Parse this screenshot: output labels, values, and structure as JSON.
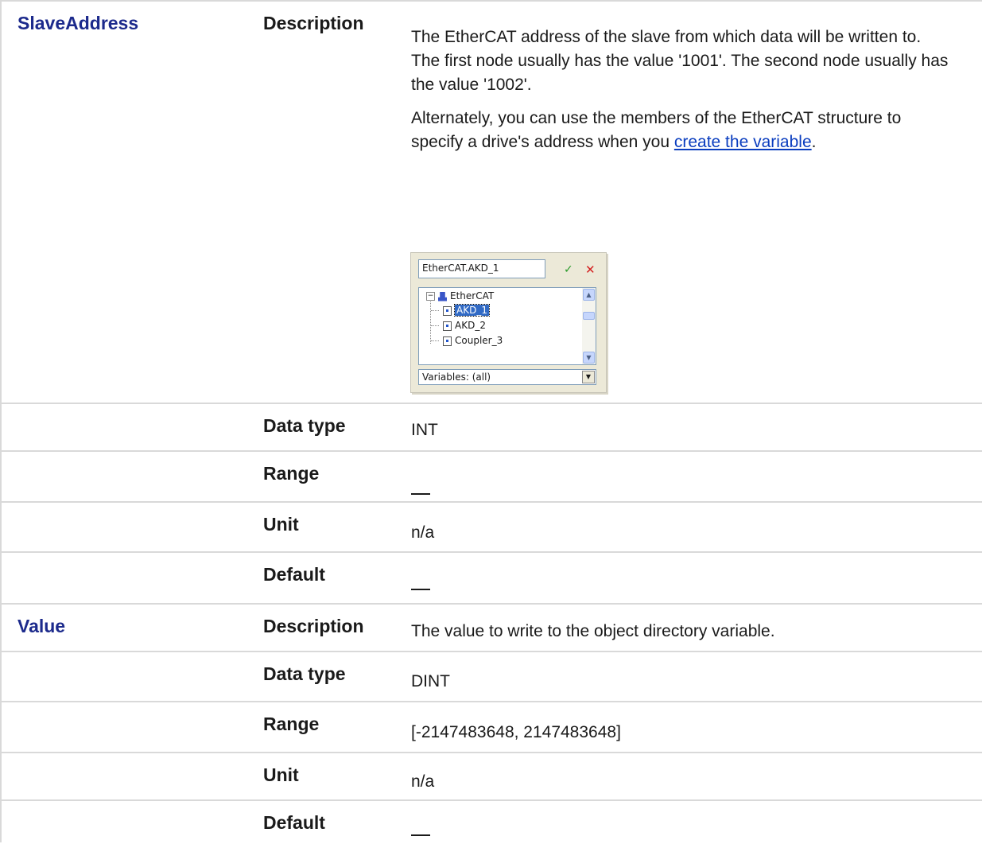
{
  "slave": {
    "name": "SlaveAddress",
    "description_label": "Description",
    "description_p1": "The EtherCAT address of the slave from which data will be written to.",
    "description_p2": "The first node usually has the value '1001'. The second node usually has the value '1002'.",
    "description_p3_pre": "Alternately, you can use the members of the EtherCAT structure to specify a drive's address when you",
    "description_link": "create the variable",
    "description_p3_post": ".",
    "datatype_label": "Data type",
    "datatype": "INT",
    "range_label": "Range",
    "unit_label": "Unit",
    "unit": "n/a",
    "default_label": "Default"
  },
  "dialog": {
    "input_value": "EtherCAT.AKD_1",
    "tree_root": "EtherCAT",
    "tree_items": [
      "AKD_1",
      "AKD_2",
      "Coupler_3"
    ],
    "filter_value": "Variables: (all)"
  },
  "value": {
    "name": "Value",
    "description_label": "Description",
    "description": "The value to write to the object directory variable.",
    "datatype_label": "Data type",
    "datatype": "DINT",
    "range_label": "Range",
    "range": "[-2147483648, 2147483648]",
    "unit_label": "Unit",
    "unit": "n/a",
    "default_label": "Default"
  }
}
